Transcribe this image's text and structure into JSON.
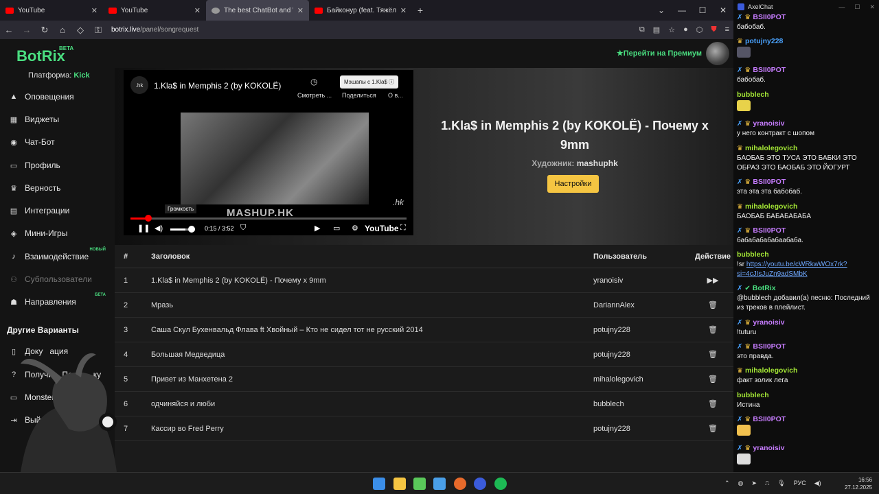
{
  "browser": {
    "tabs": [
      {
        "title": "YouTube",
        "fav": "youtube-icon"
      },
      {
        "title": "YouTube",
        "fav": "youtube-icon"
      },
      {
        "title": "The best ChatBot and Widg",
        "fav": "botrix-icon"
      },
      {
        "title": "Байконур (feat. Тяжёлая Атлет",
        "fav": "youtube-icon"
      }
    ],
    "url_host": "botrix.live",
    "url_path": "/panel/songrequest"
  },
  "sidebar": {
    "logo": "BotRix",
    "logo_badge": "BETA",
    "platform_label": "Платформа:",
    "platform_value": "Kick",
    "items": [
      {
        "label": "Оповещения",
        "icon": "warning-icon"
      },
      {
        "label": "Виджеты",
        "icon": "grid-icon"
      },
      {
        "label": "Чат-Бот",
        "icon": "robot-icon"
      },
      {
        "label": "Профиль",
        "icon": "id-card-icon"
      },
      {
        "label": "Верность",
        "icon": "trophy-icon"
      },
      {
        "label": "Интеграции",
        "icon": "server-icon"
      },
      {
        "label": "Мини-Игры",
        "icon": "gamepad-icon"
      },
      {
        "label": "Взаимодействие",
        "icon": "music-icon",
        "badge": "НОВЫЙ"
      },
      {
        "label": "Субпользователи",
        "icon": "users-icon"
      },
      {
        "label": "Направления",
        "icon": "user-direction-icon",
        "badge": "БЕТА"
      }
    ],
    "other_heading": "Другие Варианты",
    "other_items": [
      {
        "label": "Доку   ация",
        "icon": "document-icon"
      },
      {
        "label": "Получи    Под       ку",
        "icon": "question-icon"
      },
      {
        "label": "Monsterb",
        "icon": "monitor-icon"
      },
      {
        "label": "Выйти",
        "icon": "logout-icon"
      }
    ]
  },
  "header": {
    "premium_label": "Перейти на Премиум"
  },
  "player": {
    "title": "1.Kla$ in Memphis 2 (by KOKOLË)",
    "channel_badge": ".hk",
    "watch_later": "Смотреть ...",
    "share": "Поделиться",
    "about": "О в...",
    "mashup_button": "Мэшапы с 1.Kla$",
    "watermark": "MASHUP.HK",
    "corner_mark": ".hk",
    "volume_tooltip": "Громкость",
    "time": "0:15 / 3:52",
    "brand": "YouTube",
    "progress": 0.065,
    "volume": 0.6
  },
  "now_playing": {
    "title": "1.Kla$ in Memphis 2 (by KOKOLË) - Почему x 9mm",
    "artist_label": "Художник:",
    "artist": "mashuphk",
    "settings_button": "Настройки"
  },
  "queue": {
    "headers": {
      "num": "#",
      "title": "Заголовок",
      "user": "Пользователь",
      "action": "Действие"
    },
    "rows": [
      {
        "num": "1",
        "title": "1.Kla$ in Memphis 2 (by KOKOLË) - Почему x 9mm",
        "user": "yranoisiv",
        "action": "skip"
      },
      {
        "num": "2",
        "title": "Мразь",
        "user": "DariannAlex",
        "action": "delete"
      },
      {
        "num": "3",
        "title": "Саша Скул Бухенвальд Флава ft Хвойный – Кто не сидел тот не русский 2014",
        "user": "potujny228",
        "action": "delete"
      },
      {
        "num": "4",
        "title": "Большая Медведица",
        "user": "potujny228",
        "action": "delete"
      },
      {
        "num": "5",
        "title": "Привет из Манхетена 2",
        "user": "mihalolegovich",
        "action": "delete"
      },
      {
        "num": "6",
        "title": "одчиняйся и люби",
        "user": "bubblech",
        "action": "delete"
      },
      {
        "num": "7",
        "title": "Кассир во Fred Perry",
        "user": "potujny228",
        "action": "delete"
      }
    ]
  },
  "chat": {
    "app_title": "AxelChat",
    "messages": [
      {
        "user": "BSII0POT",
        "color": "#c77dff",
        "mod": true,
        "crown": true,
        "text": "бабобаб."
      },
      {
        "user": "potujny228",
        "color": "#4aa3ff",
        "mod": false,
        "crown": true,
        "text": ""
      },
      {
        "user": "BSII0POT",
        "color": "#c77dff",
        "mod": true,
        "crown": true,
        "text": "бабобаб."
      },
      {
        "user": "bubblech",
        "color": "#a3e635",
        "mod": false,
        "crown": false,
        "text": ""
      },
      {
        "user": "yranoisiv",
        "color": "#c77dff",
        "mod": true,
        "crown": true,
        "text": "у него контракт с шопом"
      },
      {
        "user": "mihalolegovich",
        "color": "#a3e635",
        "mod": false,
        "crown": true,
        "text": "БАОБАБ ЭТО ТУСА ЭТО БАБКИ ЭТО ОБРАЗ ЭТО БАОБАБ ЭТО ЙОГУРТ"
      },
      {
        "user": "BSII0POT",
        "color": "#c77dff",
        "mod": true,
        "crown": true,
        "text": "эта эта эта бабобаб."
      },
      {
        "user": "mihalolegovich",
        "color": "#a3e635",
        "mod": false,
        "crown": true,
        "text": "БАОБАБ БАБАБАБАБА"
      },
      {
        "user": "BSII0POT",
        "color": "#c77dff",
        "mod": true,
        "crown": true,
        "text": "бабабабабабаабаба."
      },
      {
        "user": "bubblech",
        "color": "#a3e635",
        "mod": false,
        "crown": false,
        "text": "!sr ",
        "link": "https://youtu.be/cWRkwWOx7rk?si=4cJIsJuZn9adSMbK"
      },
      {
        "user": "BotRix",
        "color": "#4ade80",
        "mod": true,
        "crown": false,
        "verified": true,
        "text": "@bubblech добавил(а) песню: Последний из треков в плейлист."
      },
      {
        "user": "yranoisiv",
        "color": "#c77dff",
        "mod": true,
        "crown": true,
        "text": "!tuturu"
      },
      {
        "user": "BSII0POT",
        "color": "#c77dff",
        "mod": true,
        "crown": true,
        "text": "это правда."
      },
      {
        "user": "mihalolegovich",
        "color": "#a3e635",
        "mod": false,
        "crown": true,
        "text": "факт золик лега"
      },
      {
        "user": "bubblech",
        "color": "#a3e635",
        "mod": false,
        "crown": false,
        "text": "Истина"
      },
      {
        "user": "BSII0POT",
        "color": "#c77dff",
        "mod": true,
        "crown": true,
        "text": ""
      },
      {
        "user": "yranoisiv",
        "color": "#c77dff",
        "mod": true,
        "crown": true,
        "text": ""
      }
    ]
  },
  "taskbar": {
    "lang": "РУС",
    "time": "16:56",
    "date": "27.12.2025"
  }
}
